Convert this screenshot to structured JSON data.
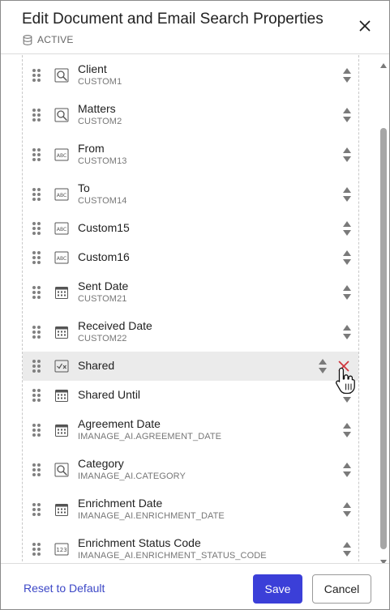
{
  "dialog": {
    "title": "Edit Document and Email Search Properties",
    "status_label": "ACTIVE",
    "status_icon": "database-icon",
    "close_icon": "close-icon"
  },
  "fields": [
    {
      "label": "Client",
      "sub": "CUSTOM1",
      "icon": "lookup-icon"
    },
    {
      "label": "Matters",
      "sub": "CUSTOM2",
      "icon": "lookup-icon"
    },
    {
      "label": "From",
      "sub": "CUSTOM13",
      "icon": "text-abc-icon"
    },
    {
      "label": "To",
      "sub": "CUSTOM14",
      "icon": "text-abc-icon"
    },
    {
      "label": "Custom15",
      "sub": "",
      "icon": "text-abc-icon"
    },
    {
      "label": "Custom16",
      "sub": "",
      "icon": "text-abc-icon"
    },
    {
      "label": "Sent Date",
      "sub": "CUSTOM21",
      "icon": "calendar-icon"
    },
    {
      "label": "Received Date",
      "sub": "CUSTOM22",
      "icon": "calendar-icon"
    },
    {
      "label": "Shared",
      "sub": "",
      "icon": "boolean-checkbox-icon",
      "hovered": true
    },
    {
      "label": "Shared Until",
      "sub": "",
      "icon": "calendar-icon"
    },
    {
      "label": "Agreement Date",
      "sub": "IMANAGE_AI.AGREEMENT_DATE",
      "icon": "calendar-icon"
    },
    {
      "label": "Category",
      "sub": "IMANAGE_AI.CATEGORY",
      "icon": "lookup-icon"
    },
    {
      "label": "Enrichment Date",
      "sub": "IMANAGE_AI.ENRICHMENT_DATE",
      "icon": "calendar-icon"
    },
    {
      "label": "Enrichment Status Code",
      "sub": "IMANAGE_AI.ENRICHMENT_STATUS_CODE",
      "icon": "number-123-icon"
    }
  ],
  "footer": {
    "reset_label": "Reset to Default",
    "save_label": "Save",
    "cancel_label": "Cancel"
  },
  "colors": {
    "accent": "#3b3fd8",
    "link": "#3d48c7",
    "remove": "#d0343b",
    "hover_row": "#ebebeb"
  }
}
